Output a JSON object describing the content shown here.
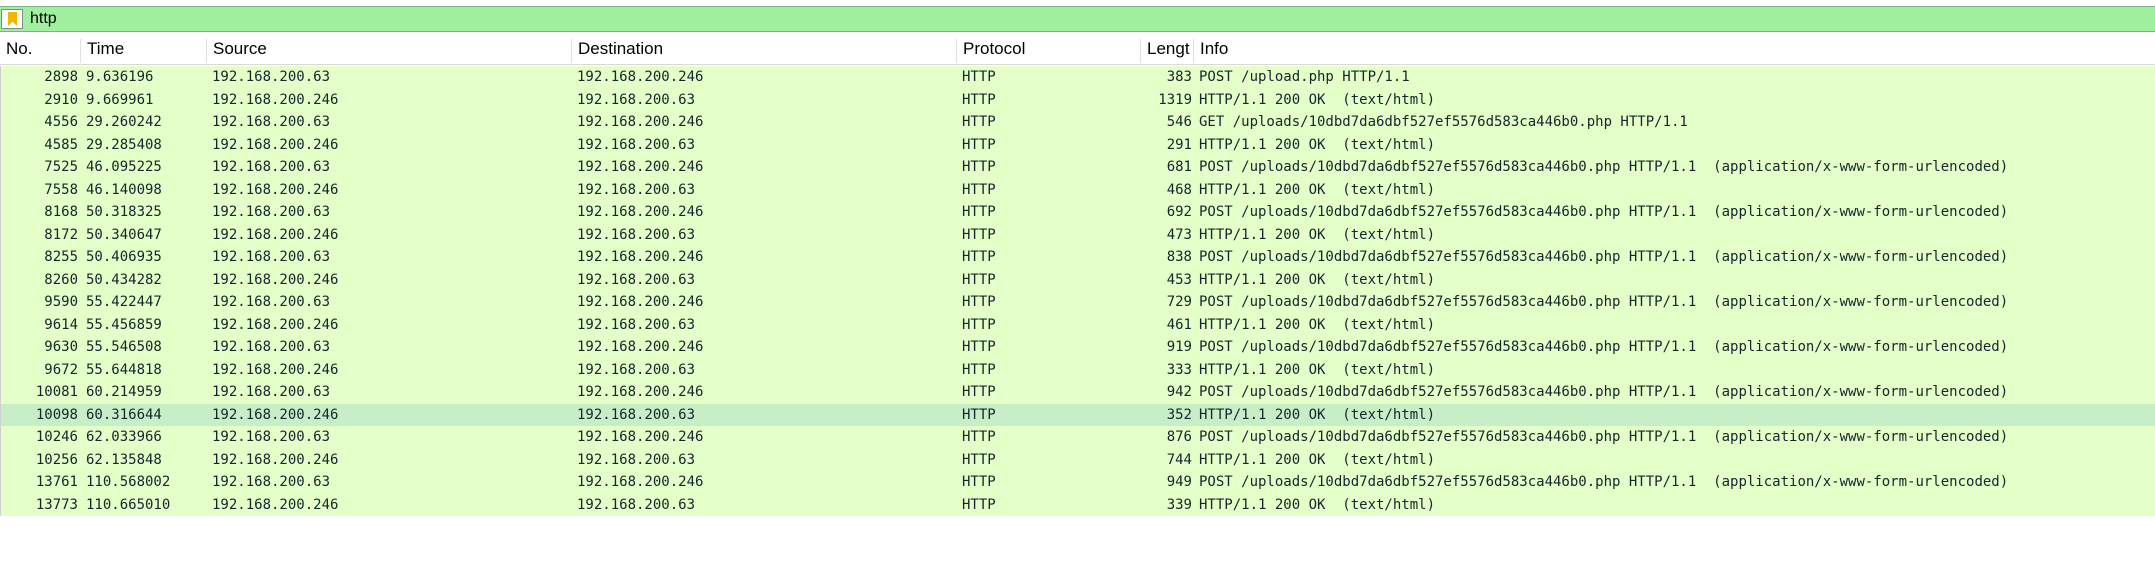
{
  "filter": {
    "value": "http",
    "icon": "bookmark-icon"
  },
  "columns": [
    "No.",
    "Time",
    "Source",
    "Destination",
    "Protocol",
    "Lengt",
    "Info"
  ],
  "colors": {
    "filter_bg": "#a0f0a0",
    "row_bg": "#e4ffc7",
    "selected_row_bg": "#c8eec8"
  },
  "packets": [
    {
      "no": "2898",
      "time": "9.636196",
      "src": "192.168.200.63",
      "dst": "192.168.200.246",
      "proto": "HTTP",
      "len": "383",
      "info": "POST /upload.php HTTP/1.1"
    },
    {
      "no": "2910",
      "time": "9.669961",
      "src": "192.168.200.246",
      "dst": "192.168.200.63",
      "proto": "HTTP",
      "len": "1319",
      "info": "HTTP/1.1 200 OK  (text/html)"
    },
    {
      "no": "4556",
      "time": "29.260242",
      "src": "192.168.200.63",
      "dst": "192.168.200.246",
      "proto": "HTTP",
      "len": "546",
      "info": "GET /uploads/10dbd7da6dbf527ef5576d583ca446b0.php HTTP/1.1"
    },
    {
      "no": "4585",
      "time": "29.285408",
      "src": "192.168.200.246",
      "dst": "192.168.200.63",
      "proto": "HTTP",
      "len": "291",
      "info": "HTTP/1.1 200 OK  (text/html)"
    },
    {
      "no": "7525",
      "time": "46.095225",
      "src": "192.168.200.63",
      "dst": "192.168.200.246",
      "proto": "HTTP",
      "len": "681",
      "info": "POST /uploads/10dbd7da6dbf527ef5576d583ca446b0.php HTTP/1.1  (application/x-www-form-urlencoded)"
    },
    {
      "no": "7558",
      "time": "46.140098",
      "src": "192.168.200.246",
      "dst": "192.168.200.63",
      "proto": "HTTP",
      "len": "468",
      "info": "HTTP/1.1 200 OK  (text/html)"
    },
    {
      "no": "8168",
      "time": "50.318325",
      "src": "192.168.200.63",
      "dst": "192.168.200.246",
      "proto": "HTTP",
      "len": "692",
      "info": "POST /uploads/10dbd7da6dbf527ef5576d583ca446b0.php HTTP/1.1  (application/x-www-form-urlencoded)"
    },
    {
      "no": "8172",
      "time": "50.340647",
      "src": "192.168.200.246",
      "dst": "192.168.200.63",
      "proto": "HTTP",
      "len": "473",
      "info": "HTTP/1.1 200 OK  (text/html)"
    },
    {
      "no": "8255",
      "time": "50.406935",
      "src": "192.168.200.63",
      "dst": "192.168.200.246",
      "proto": "HTTP",
      "len": "838",
      "info": "POST /uploads/10dbd7da6dbf527ef5576d583ca446b0.php HTTP/1.1  (application/x-www-form-urlencoded)"
    },
    {
      "no": "8260",
      "time": "50.434282",
      "src": "192.168.200.246",
      "dst": "192.168.200.63",
      "proto": "HTTP",
      "len": "453",
      "info": "HTTP/1.1 200 OK  (text/html)"
    },
    {
      "no": "9590",
      "time": "55.422447",
      "src": "192.168.200.63",
      "dst": "192.168.200.246",
      "proto": "HTTP",
      "len": "729",
      "info": "POST /uploads/10dbd7da6dbf527ef5576d583ca446b0.php HTTP/1.1  (application/x-www-form-urlencoded)"
    },
    {
      "no": "9614",
      "time": "55.456859",
      "src": "192.168.200.246",
      "dst": "192.168.200.63",
      "proto": "HTTP",
      "len": "461",
      "info": "HTTP/1.1 200 OK  (text/html)"
    },
    {
      "no": "9630",
      "time": "55.546508",
      "src": "192.168.200.63",
      "dst": "192.168.200.246",
      "proto": "HTTP",
      "len": "919",
      "info": "POST /uploads/10dbd7da6dbf527ef5576d583ca446b0.php HTTP/1.1  (application/x-www-form-urlencoded)"
    },
    {
      "no": "9672",
      "time": "55.644818",
      "src": "192.168.200.246",
      "dst": "192.168.200.63",
      "proto": "HTTP",
      "len": "333",
      "info": "HTTP/1.1 200 OK  (text/html)"
    },
    {
      "no": "10081",
      "time": "60.214959",
      "src": "192.168.200.63",
      "dst": "192.168.200.246",
      "proto": "HTTP",
      "len": "942",
      "info": "POST /uploads/10dbd7da6dbf527ef5576d583ca446b0.php HTTP/1.1  (application/x-www-form-urlencoded)"
    },
    {
      "no": "10098",
      "time": "60.316644",
      "src": "192.168.200.246",
      "dst": "192.168.200.63",
      "proto": "HTTP",
      "len": "352",
      "info": "HTTP/1.1 200 OK  (text/html)",
      "selected": true
    },
    {
      "no": "10246",
      "time": "62.033966",
      "src": "192.168.200.63",
      "dst": "192.168.200.246",
      "proto": "HTTP",
      "len": "876",
      "info": "POST /uploads/10dbd7da6dbf527ef5576d583ca446b0.php HTTP/1.1  (application/x-www-form-urlencoded)"
    },
    {
      "no": "10256",
      "time": "62.135848",
      "src": "192.168.200.246",
      "dst": "192.168.200.63",
      "proto": "HTTP",
      "len": "744",
      "info": "HTTP/1.1 200 OK  (text/html)"
    },
    {
      "no": "13761",
      "time": "110.568002",
      "src": "192.168.200.63",
      "dst": "192.168.200.246",
      "proto": "HTTP",
      "len": "949",
      "info": "POST /uploads/10dbd7da6dbf527ef5576d583ca446b0.php HTTP/1.1  (application/x-www-form-urlencoded)"
    },
    {
      "no": "13773",
      "time": "110.665010",
      "src": "192.168.200.246",
      "dst": "192.168.200.63",
      "proto": "HTTP",
      "len": "339",
      "info": "HTTP/1.1 200 OK  (text/html)"
    }
  ]
}
